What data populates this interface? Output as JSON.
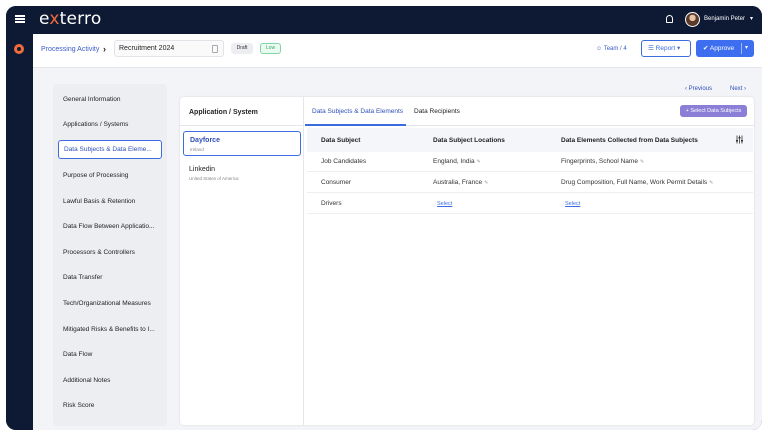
{
  "app": {
    "logo": "exterro",
    "user_name": "Benjamin Peter"
  },
  "header": {
    "breadcrumb": "Processing Activity",
    "record_name": "Recruitment 2024",
    "status_badge": "Draft",
    "risk_badge": "Low",
    "team": "Team / 4",
    "report_label": "Report",
    "approve_label": "Approve"
  },
  "pager": {
    "prev": "Previous",
    "next": "Next"
  },
  "sidebar": {
    "items": [
      {
        "label": "General Information"
      },
      {
        "label": "Applications / Systems"
      },
      {
        "label": "Data Subjects & Data Eleme..."
      },
      {
        "label": "Purpose of Processing"
      },
      {
        "label": "Lawful Basis & Retention"
      },
      {
        "label": "Data Flow Between Applicatio..."
      },
      {
        "label": "Processors & Controllers"
      },
      {
        "label": "Data Transfer"
      },
      {
        "label": "Tech/Organizational Measures"
      },
      {
        "label": "Mitigated Risks & Benefits to I..."
      },
      {
        "label": "Data Flow"
      },
      {
        "label": "Additional Notes"
      },
      {
        "label": "Risk Score"
      }
    ]
  },
  "apps": {
    "header": "Application / System",
    "items": [
      {
        "name": "Dayforce",
        "location": "Ireland"
      },
      {
        "name": "Linkedin",
        "location": "United States of America"
      }
    ]
  },
  "tabs": {
    "items": [
      {
        "label": "Data Subjects & Data Elements"
      },
      {
        "label": "Data Recipients"
      }
    ],
    "select_button": "+ Select Data Subjects"
  },
  "table": {
    "headers": [
      "Data Subject",
      "Data Subject Locations",
      "Data Elements Collected from Data Subjects"
    ],
    "rows": [
      {
        "subject": "Job Candidates",
        "locations": "England, India",
        "elements": "Fingerprints, School Name"
      },
      {
        "subject": "Consumer",
        "locations": "Australia, France",
        "elements": "Drug Composition, Full Name, Work Permit Details"
      },
      {
        "subject": "Drivers",
        "locations": "Select",
        "elements": "Select"
      }
    ]
  },
  "colors": {
    "brand_navy": "#0e1a34",
    "accent_orange": "#f26b3a",
    "primary_blue": "#3d6ef0",
    "purple_button": "#8a7ed6"
  },
  "icons": [
    "hamburger-icon",
    "bell-icon",
    "team-icon",
    "filter-settings-icon",
    "pencil-icon",
    "document-icon"
  ]
}
